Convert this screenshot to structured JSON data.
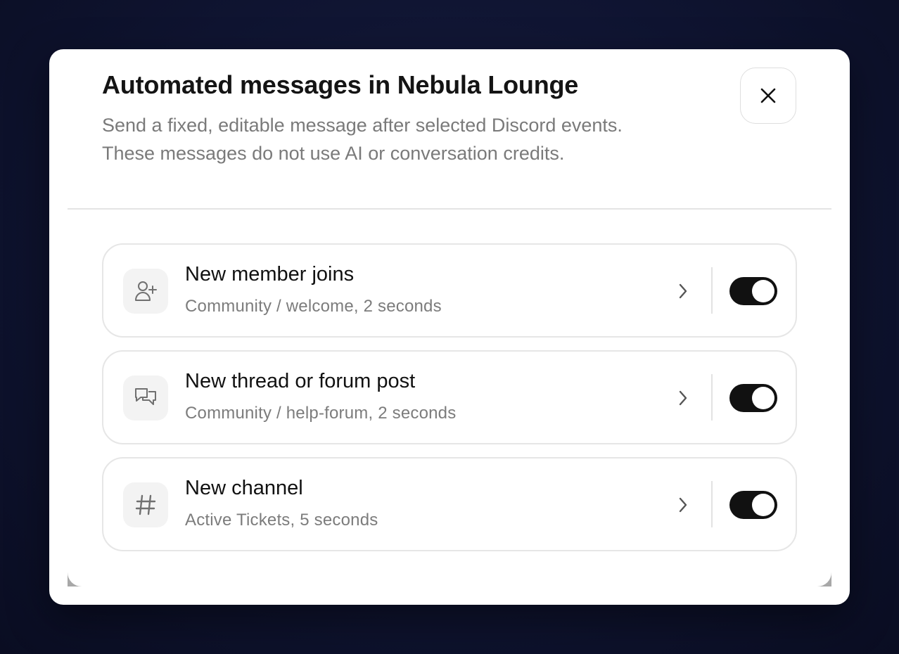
{
  "dialog": {
    "title": "Automated messages in Nebula Lounge",
    "subtitle_line1": "Send a fixed, editable message after selected Discord events.",
    "subtitle_line2": "These messages do not use AI or conversation credits.",
    "close_icon": "close-icon"
  },
  "automations": [
    {
      "title": "New member joins",
      "subtitle": "Community / welcome, 2 seconds",
      "icon": "user-plus-icon",
      "enabled": true
    },
    {
      "title": "New thread or forum post",
      "subtitle": "Community / help-forum, 2 seconds",
      "icon": "messages-icon",
      "enabled": true
    },
    {
      "title": "New channel",
      "subtitle": "Active Tickets, 5 seconds",
      "icon": "hash-icon",
      "enabled": true
    }
  ],
  "colors": {
    "background": "#0f1431",
    "toggle_on": "#111111",
    "muted_text": "#7a7a7a"
  }
}
